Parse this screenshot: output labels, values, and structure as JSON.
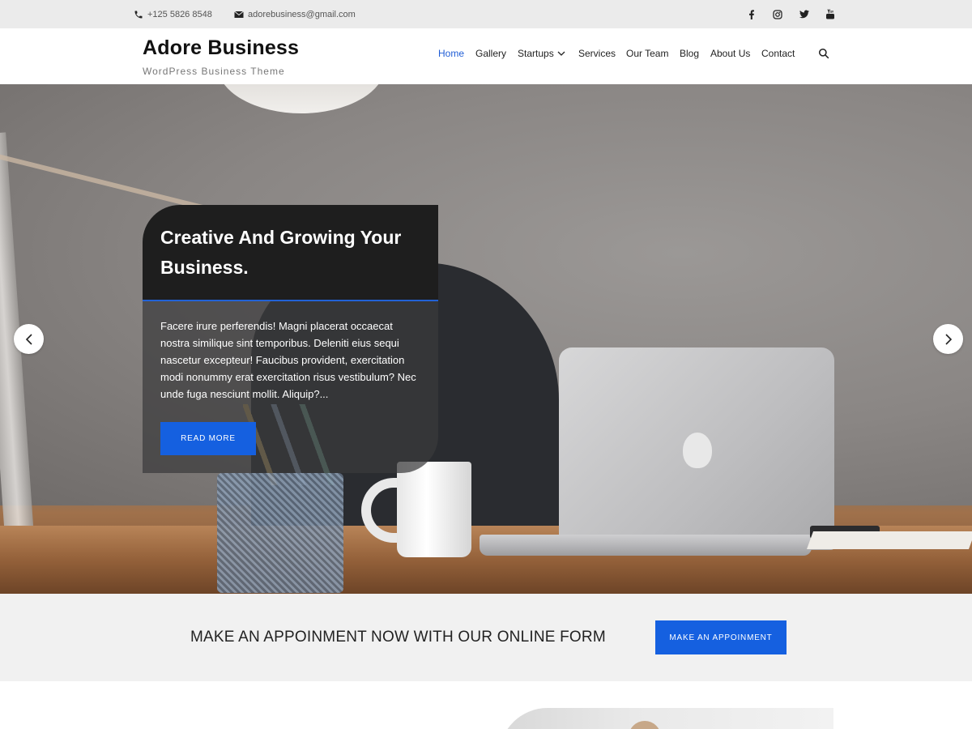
{
  "topbar": {
    "phone": "+125 5826 8548",
    "email": "adorebusiness@gmail.com",
    "social_icons": [
      "facebook-icon",
      "instagram-icon",
      "twitter-icon",
      "youtube-icon"
    ]
  },
  "header": {
    "site_title": "Adore Business",
    "tagline": "WordPress Business Theme",
    "nav": [
      {
        "label": "Home",
        "active": true
      },
      {
        "label": "Gallery",
        "active": false
      },
      {
        "label": "Startups",
        "active": false,
        "has_dropdown": true
      },
      {
        "label": "Services",
        "active": false
      },
      {
        "label": "Our Team",
        "active": false
      },
      {
        "label": "Blog",
        "active": false
      },
      {
        "label": "About Us",
        "active": false
      },
      {
        "label": "Contact",
        "active": false
      }
    ],
    "search_icon": "search-icon"
  },
  "hero": {
    "title": "Creative And Growing Your Business.",
    "description": "Facere irure perferendis! Magni placerat occaecat nostra similique sint temporibus. Deleniti eius sequi nascetur excepteur! Faucibus provident, exercitation modi nonummy erat exercitation risus vestibulum? Nec unde fuga nesciunt mollit. Aliquip?...",
    "button_label": "READ MORE",
    "prev_icon": "chevron-left-icon",
    "next_icon": "chevron-right-icon"
  },
  "cta": {
    "text": "MAKE AN APPOINMENT NOW WITH OUR ONLINE FORM",
    "button_label": "MAKE AN APPOINMENT"
  },
  "colors": {
    "accent": "#1560e0",
    "active_nav": "#1f5dd6",
    "topbar_bg": "#ebebeb",
    "cta_bg": "#f1f1f1"
  }
}
